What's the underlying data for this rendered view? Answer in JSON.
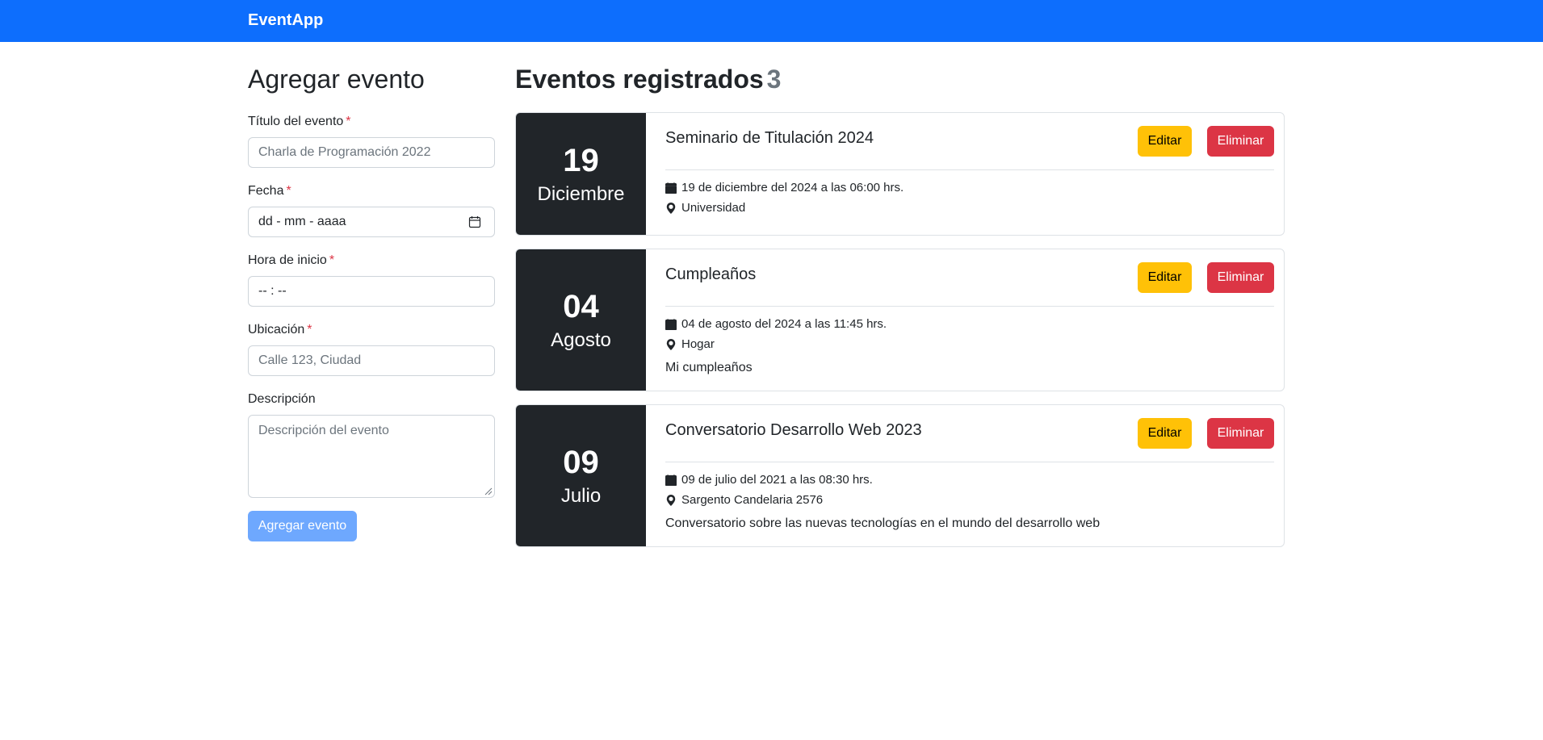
{
  "navbar": {
    "brand": "EventApp"
  },
  "form": {
    "title": "Agregar evento",
    "required_mark": "*",
    "fields": {
      "title": {
        "label": "Título del evento",
        "placeholder": "Charla de Programación 2022"
      },
      "date": {
        "label": "Fecha",
        "value": "dd - mm - aaaa"
      },
      "time": {
        "label": "Hora de inicio",
        "value": "-- : --"
      },
      "location": {
        "label": "Ubicación",
        "placeholder": "Calle 123, Ciudad"
      },
      "description": {
        "label": "Descripción",
        "placeholder": "Descripción del evento"
      }
    },
    "submit_label": "Agregar evento"
  },
  "list": {
    "title": "Eventos registrados",
    "count": "3",
    "edit_label": "Editar",
    "delete_label": "Eliminar",
    "events": [
      {
        "day": "19",
        "month": "Diciembre",
        "title": "Seminario de Titulación 2024",
        "datetime": "19 de diciembre del 2024 a las 06:00 hrs.",
        "location": "Universidad",
        "description": ""
      },
      {
        "day": "04",
        "month": "Agosto",
        "title": "Cumpleaños",
        "datetime": "04 de agosto del 2024 a las 11:45 hrs.",
        "location": "Hogar",
        "description": "Mi cumpleaños"
      },
      {
        "day": "09",
        "month": "Julio",
        "title": "Conversatorio Desarrollo Web 2023",
        "datetime": "09 de julio del 2021 a las 08:30 hrs.",
        "location": "Sargento Candelaria 2576",
        "description": "Conversatorio sobre las nuevas tecnologías en el mundo del desarrollo web"
      }
    ]
  },
  "colors": {
    "navbar": "#0d6efd",
    "date_block": "#212529",
    "edit_button": "#ffc107",
    "delete_button": "#dc3545",
    "submit_button": "#6ea8fe",
    "required": "#dc3545"
  },
  "icons": {
    "calendar": "calendar-icon",
    "location": "map-pin-icon",
    "date_picker": "calendar-picker-icon"
  }
}
